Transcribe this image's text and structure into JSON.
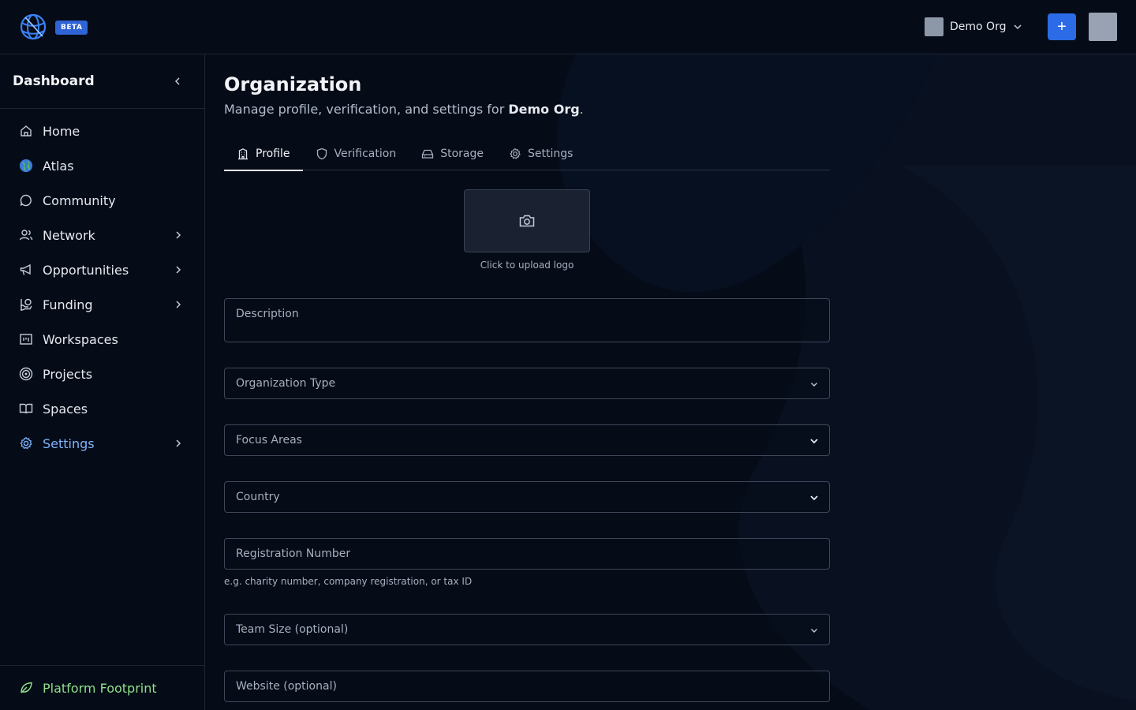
{
  "topbar": {
    "beta_label": "BETA",
    "org_name": "Demo Org",
    "add_label": "+"
  },
  "sidebar": {
    "title": "Dashboard",
    "items": [
      {
        "label": "Home",
        "icon": "home-icon",
        "has_children": false
      },
      {
        "label": "Atlas",
        "icon": "globe-icon",
        "has_children": false
      },
      {
        "label": "Community",
        "icon": "chat-bubble-icon",
        "has_children": false
      },
      {
        "label": "Network",
        "icon": "users-icon",
        "has_children": true
      },
      {
        "label": "Opportunities",
        "icon": "megaphone-icon",
        "has_children": true
      },
      {
        "label": "Funding",
        "icon": "hand-coin-icon",
        "has_children": true
      },
      {
        "label": "Workspaces",
        "icon": "kanban-icon",
        "has_children": false
      },
      {
        "label": "Projects",
        "icon": "target-icon",
        "has_children": false
      },
      {
        "label": "Spaces",
        "icon": "book-open-icon",
        "has_children": false
      },
      {
        "label": "Settings",
        "icon": "gear-icon",
        "has_children": true,
        "active": true
      }
    ],
    "footer_label": "Platform Footprint"
  },
  "page": {
    "title": "Organization",
    "subtitle_prefix": "Manage profile, verification, and settings for ",
    "subtitle_org": "Demo Org",
    "subtitle_suffix": "."
  },
  "tabs": [
    {
      "label": "Profile",
      "icon": "building-icon",
      "active": true
    },
    {
      "label": "Verification",
      "icon": "shield-icon",
      "active": false
    },
    {
      "label": "Storage",
      "icon": "hard-drive-icon",
      "active": false
    },
    {
      "label": "Settings",
      "icon": "gear-icon",
      "active": false
    }
  ],
  "upload": {
    "hint": "Click to upload logo"
  },
  "form": {
    "description": "Description",
    "org_type": "Organization Type",
    "focus_areas": "Focus Areas",
    "country": "Country",
    "registration_number": "Registration Number",
    "registration_helper": "e.g. charity number, company registration, or tax ID",
    "team_size": "Team Size (optional)",
    "website": "Website (optional)"
  },
  "colors": {
    "background": "#050b17",
    "accent": "#2b6be6",
    "active_nav": "#7fb4ff",
    "footer_green": "#8fe08a"
  }
}
